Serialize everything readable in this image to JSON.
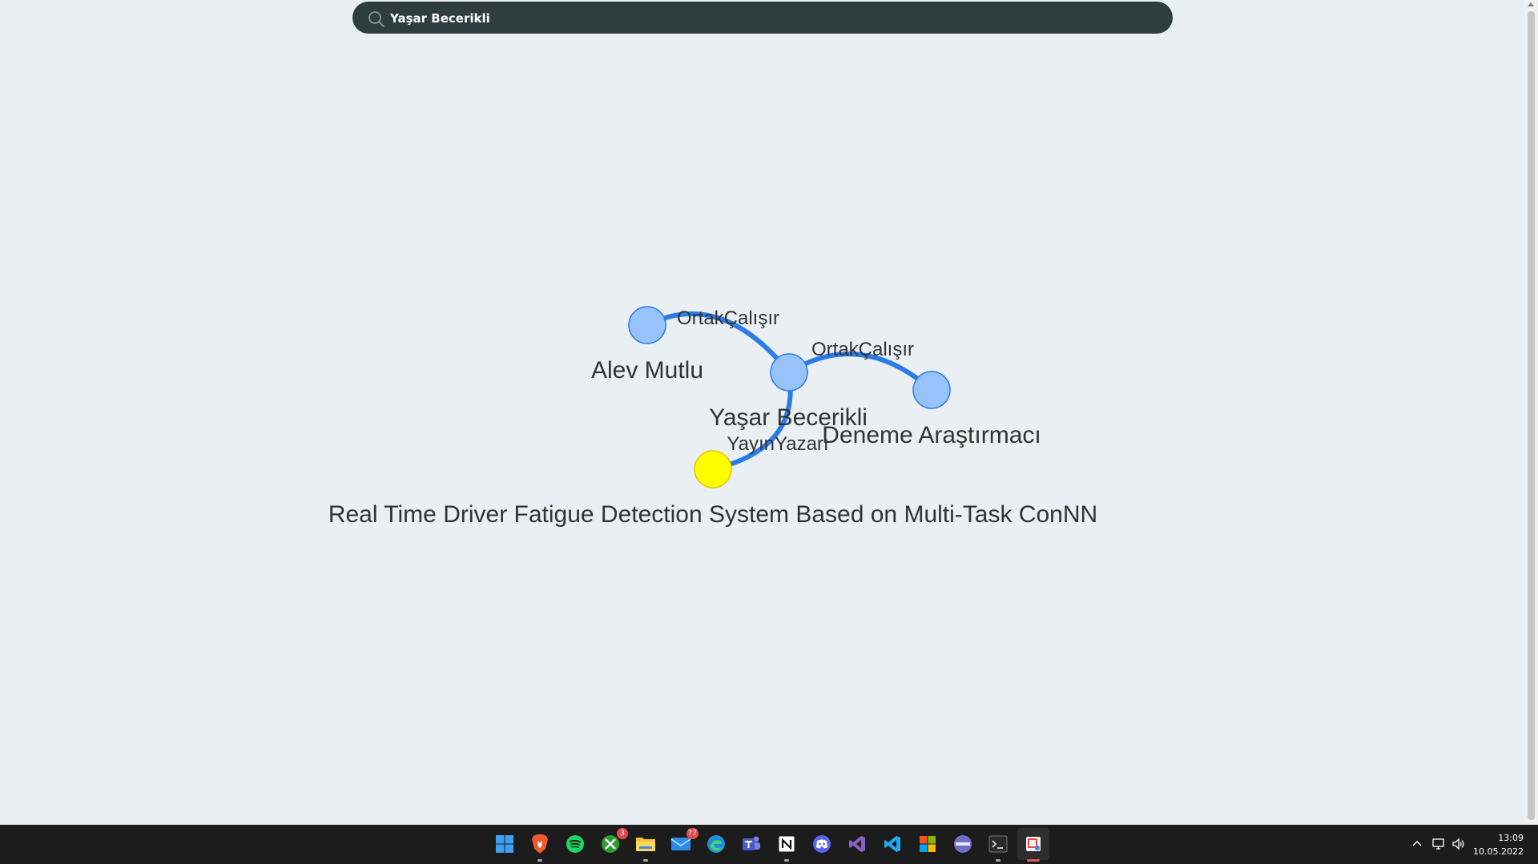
{
  "search": {
    "value": "Yaşar Becerikli"
  },
  "graph": {
    "nodes": [
      {
        "id": "alev",
        "label": "Alev Mutlu",
        "color": "#97c2fc"
      },
      {
        "id": "yasar",
        "label": "Yaşar Becerikli",
        "color": "#97c2fc"
      },
      {
        "id": "deneme",
        "label": "Deneme Araştırmacı",
        "color": "#97c2fc"
      },
      {
        "id": "paper",
        "label": "Real Time Driver Fatigue Detection System Based on Multi-Task ConNN",
        "color": "#ffff00"
      }
    ],
    "edges": [
      {
        "from": "alev",
        "to": "yasar",
        "label": "OrtakÇalışır"
      },
      {
        "from": "yasar",
        "to": "deneme",
        "label": "OrtakÇalışır"
      },
      {
        "from": "yasar",
        "to": "paper",
        "label": "YayınYazarı"
      }
    ],
    "edge_color": "#2b7ce9"
  },
  "taskbar": {
    "apps": [
      {
        "name": "start-icon"
      },
      {
        "name": "brave-browser-icon"
      },
      {
        "name": "spotify-icon"
      },
      {
        "name": "xbox-icon",
        "badge": "3"
      },
      {
        "name": "file-explorer-icon"
      },
      {
        "name": "mail-icon",
        "badge": "77"
      },
      {
        "name": "edge-browser-icon"
      },
      {
        "name": "teams-icon"
      },
      {
        "name": "notion-icon"
      },
      {
        "name": "discord-icon"
      },
      {
        "name": "visual-studio-icon"
      },
      {
        "name": "vscode-icon"
      },
      {
        "name": "office-icon"
      },
      {
        "name": "app-icon"
      },
      {
        "name": "terminal-icon"
      },
      {
        "name": "snipping-tool-icon"
      }
    ],
    "tray": {
      "time": "13:09",
      "date": "10.05.2022"
    }
  }
}
